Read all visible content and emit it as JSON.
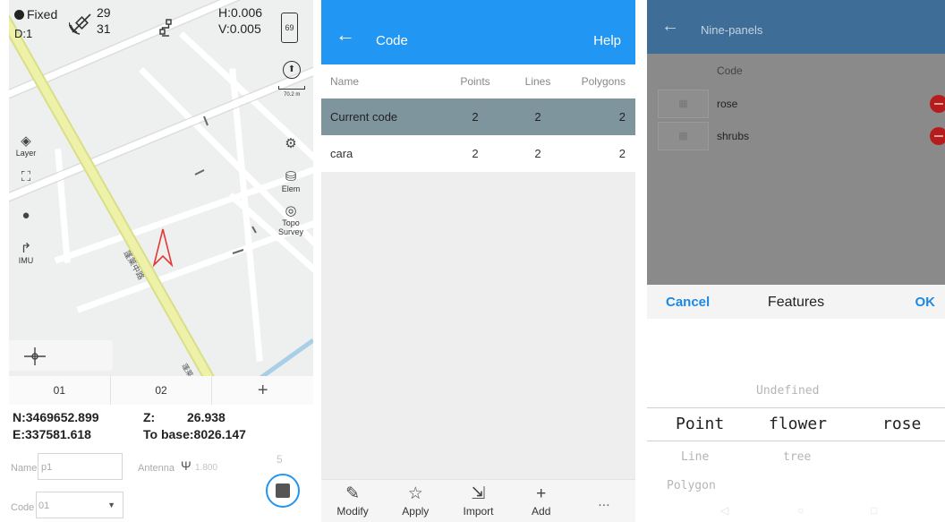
{
  "panel_map": {
    "status": {
      "fix_label": "Fixed",
      "diff_label": "D:1",
      "sats_used": "29",
      "sats_total": "31",
      "h_precision": "H:0.006",
      "v_precision": "V:0.005",
      "battery": "69"
    },
    "scale_label": "70.2 m",
    "side_buttons": {
      "layer": "Layer",
      "imu": "IMU",
      "elem": "Elem",
      "topo": "Topo Survey"
    },
    "tabs": [
      "01",
      "02"
    ],
    "add_tab": "+",
    "coords": {
      "north": "N:3469652.899",
      "east": "E:337581.618",
      "z_label": "Z:",
      "z_value": "26.938",
      "to_base": "To base:8026.147"
    },
    "form": {
      "name_label": "Name",
      "name_value": "p1",
      "antenna_label": "Antenna",
      "antenna_value": "1.800",
      "counter": "5",
      "code_label": "Code",
      "code_value": "01"
    },
    "road_label_1": "蓬莱中路",
    "road_label_2": "蓬莱中"
  },
  "panel_code": {
    "title": "Code",
    "help": "Help",
    "columns": [
      "Name",
      "Points",
      "Lines",
      "Polygons"
    ],
    "rows": [
      {
        "name": "Current code",
        "points": "2",
        "lines": "2",
        "polygons": "2",
        "selected": true
      },
      {
        "name": "cara",
        "points": "2",
        "lines": "2",
        "polygons": "2",
        "selected": false
      }
    ],
    "toolbar": [
      "Modify",
      "Apply",
      "Import",
      "Add",
      "..."
    ]
  },
  "panel_nine": {
    "title": "Nine-panels",
    "code_header": "Code",
    "codes": [
      "rose",
      "shrubs"
    ],
    "picker": {
      "cancel": "Cancel",
      "title": "Features",
      "ok": "OK",
      "col1": [
        "Point",
        "Line",
        "Polygon"
      ],
      "col2_above": "Undefined",
      "col2": [
        "flower",
        "tree"
      ],
      "col3": [
        "rose"
      ]
    }
  }
}
